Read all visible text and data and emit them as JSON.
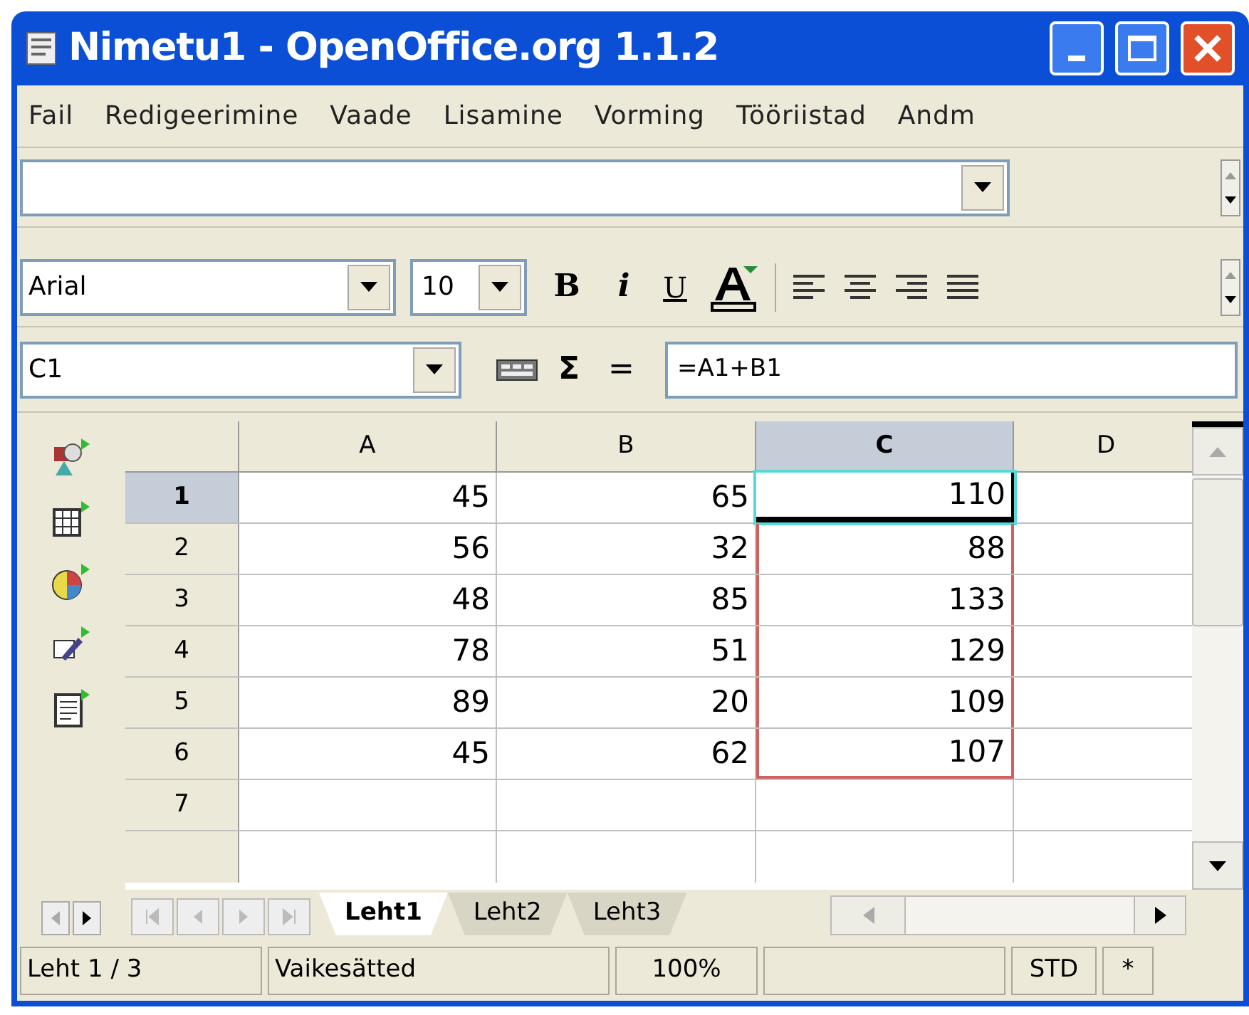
{
  "window": {
    "title": "Nimetu1 - OpenOffice.org 1.1.2"
  },
  "menu": [
    "Fail",
    "Redigeerimine",
    "Vaade",
    "Lisamine",
    "Vorming",
    "Tööriistad",
    "Andm"
  ],
  "font_toolbar": {
    "font": "Arial",
    "size": "10",
    "bold": "B",
    "italic": "i",
    "underline": "U"
  },
  "formula_bar": {
    "cell": "C1",
    "sum": "Σ",
    "equals": "=",
    "formula": "=A1+B1"
  },
  "columns": [
    {
      "label": "A",
      "selected": false
    },
    {
      "label": "B",
      "selected": false
    },
    {
      "label": "C",
      "selected": true
    },
    {
      "label": "D",
      "selected": false
    }
  ],
  "rows": [
    {
      "label": "1",
      "selected": true,
      "cells": [
        {
          "text": "45",
          "active": false,
          "referenced": false
        },
        {
          "text": "65",
          "active": false,
          "referenced": false
        },
        {
          "text": "110",
          "active": true,
          "referenced": false
        }
      ]
    },
    {
      "label": "2",
      "selected": false,
      "cells": [
        {
          "text": "56",
          "active": false,
          "referenced": false
        },
        {
          "text": "32",
          "active": false,
          "referenced": false
        },
        {
          "text": "88",
          "active": false,
          "referenced": true
        }
      ]
    },
    {
      "label": "3",
      "selected": false,
      "cells": [
        {
          "text": "48",
          "active": false,
          "referenced": false
        },
        {
          "text": "85",
          "active": false,
          "referenced": false
        },
        {
          "text": "133",
          "active": false,
          "referenced": true
        }
      ]
    },
    {
      "label": "4",
      "selected": false,
      "cells": [
        {
          "text": "78",
          "active": false,
          "referenced": false
        },
        {
          "text": "51",
          "active": false,
          "referenced": false
        },
        {
          "text": "129",
          "active": false,
          "referenced": true
        }
      ]
    },
    {
      "label": "5",
      "selected": false,
      "cells": [
        {
          "text": "89",
          "active": false,
          "referenced": false
        },
        {
          "text": "20",
          "active": false,
          "referenced": false
        },
        {
          "text": "109",
          "active": false,
          "referenced": true
        }
      ]
    },
    {
      "label": "6",
      "selected": false,
      "cells": [
        {
          "text": "45",
          "active": false,
          "referenced": false
        },
        {
          "text": "62",
          "active": false,
          "referenced": false
        },
        {
          "text": "107",
          "active": false,
          "referenced": true
        }
      ]
    },
    {
      "label": "7",
      "selected": false
    }
  ],
  "sheet_tabs": [
    {
      "label": "Leht1",
      "selected": true
    },
    {
      "label": "Leht2",
      "selected": false
    },
    {
      "label": "Leht3",
      "selected": false
    }
  ],
  "status_bar": [
    "Leht 1 / 3",
    "Vaikesätted",
    "100%",
    "STD",
    "*"
  ]
}
